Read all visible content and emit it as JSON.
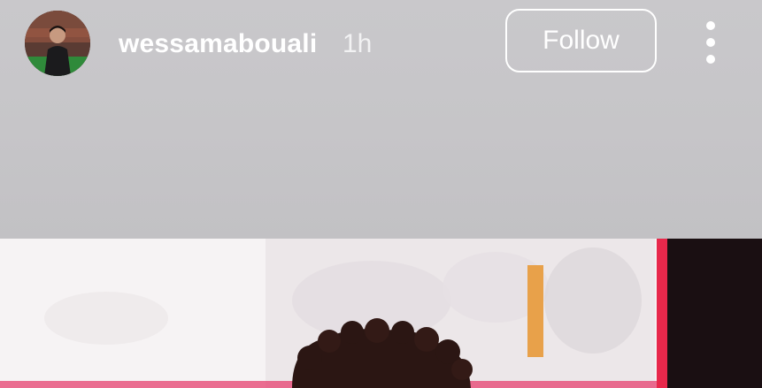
{
  "story_header": {
    "username": "wessamabouali",
    "time_ago": "1h",
    "follow_label": "Follow"
  },
  "icons": {
    "avatar": "profile-avatar",
    "more": "more-options-vertical-icon"
  },
  "colors": {
    "header_background": "#c8c6c9",
    "text": "#ffffff",
    "photo_red_edge": "#e8284b",
    "photo_dark_right": "#1a0f12",
    "photo_hair": "#2b1613"
  }
}
